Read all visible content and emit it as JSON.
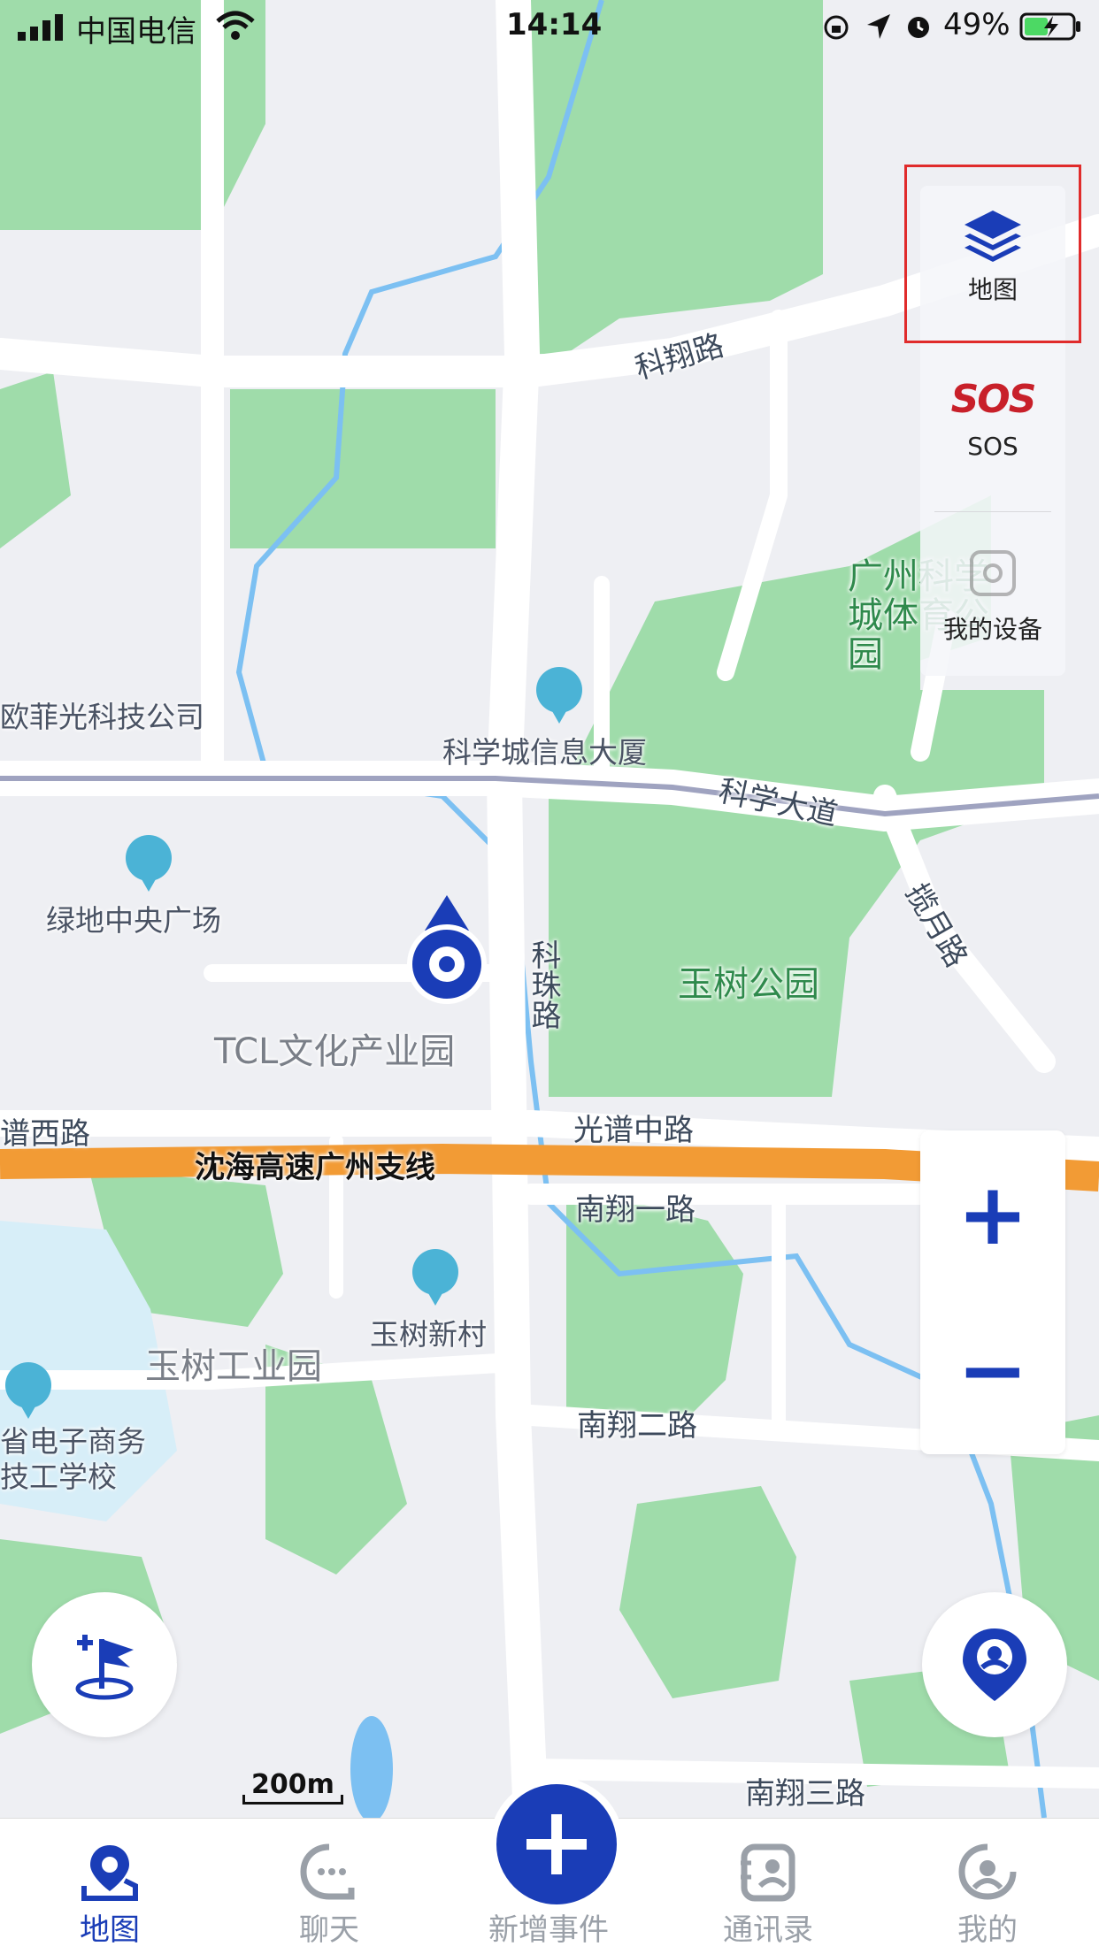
{
  "status_bar": {
    "carrier": "中国电信",
    "time": "14:14",
    "battery": "49%"
  },
  "map": {
    "road_labels": [
      "科翔路",
      "科学大道",
      "揽月路",
      "科珠路",
      "光谱中路",
      "南翔一路",
      "南翔二路",
      "南翔三路",
      "谱西路"
    ],
    "highway_label": "沈海高速广州支线",
    "park_labels": [
      "玉树公园",
      "广州科学城体育公园"
    ],
    "area_labels": [
      "TCL文化产业园",
      "玉树工业园"
    ],
    "poi_labels": [
      "科学城信息大厦",
      "绿地中央广场",
      "玉树新村",
      "欧菲光科技公司",
      "省电子商务技工学校"
    ]
  },
  "side_panel": {
    "map_label": "地图",
    "sos_logo": "SOS",
    "sos_label": "SOS",
    "device_label": "我的设备"
  },
  "zoom": {
    "in": "+",
    "out": "−"
  },
  "scale": "200m",
  "tabs": [
    {
      "label": "地图",
      "icon": "map-pin-icon",
      "active": true
    },
    {
      "label": "聊天",
      "icon": "chat-icon",
      "active": false
    },
    {
      "label": "新增事件",
      "icon": "plus-icon",
      "active": false
    },
    {
      "label": "通讯录",
      "icon": "contacts-icon",
      "active": false
    },
    {
      "label": "我的",
      "icon": "profile-icon",
      "active": false
    }
  ],
  "colors": {
    "accent": "#1a3db7",
    "park": "#9fdcaa",
    "water": "#7cc0f2",
    "highway": "#f29b35",
    "sos": "#c8202a"
  }
}
